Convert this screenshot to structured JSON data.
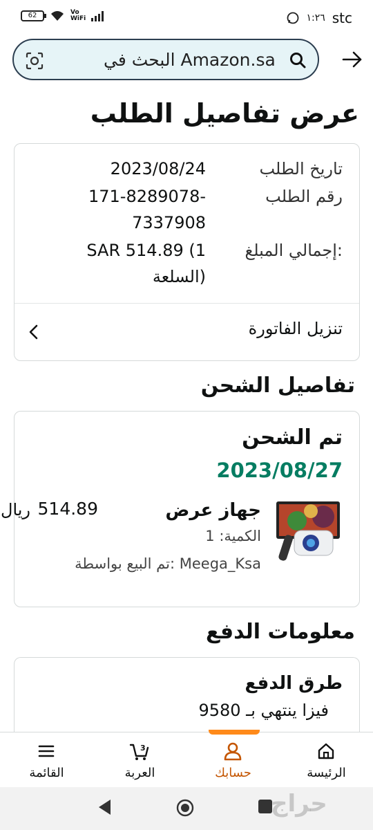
{
  "status_bar": {
    "battery": "62",
    "volte": "Vo",
    "wifi_label": "WiFi",
    "time": "١:٢٦",
    "carrier": "stc",
    "icons": [
      "battery-icon",
      "wifi-icon",
      "signal-icon",
      "whatsapp-icon"
    ]
  },
  "search": {
    "placeholder": "البحث في Amazon.sa"
  },
  "page": {
    "title": "عرض تفاصيل الطلب"
  },
  "order": {
    "date_label": "تاريخ الطلب",
    "date_value": "2023/08/24",
    "number_label": "رقم الطلب",
    "number_value_line1": "171-8289078-",
    "number_value_line2": "7337908",
    "total_label": "إجمالي المبلغ:",
    "total_value_line1": "SAR 514.89 (1",
    "total_value_line2": "السلعة)",
    "invoice_label": "تنزيل الفاتورة"
  },
  "shipping": {
    "section_title": "تفاصيل الشحن",
    "status": "تم الشحن",
    "date": "2023/08/27",
    "date_color": "#067d62",
    "item": {
      "title": "جهاز عرض",
      "quantity": "الكمية: 1",
      "seller": "تم البيع بواسطة: Meega_Ksa",
      "price": "514.89",
      "currency": "ريال"
    }
  },
  "payment": {
    "section_title": "معلومات الدفع",
    "methods_label": "طرق الدفع",
    "card_text": "فيزا ينتهي بـ 9580"
  },
  "bottom_nav": {
    "items": [
      {
        "label": "الرئيسة",
        "icon": "home-icon"
      },
      {
        "label": "حسابك",
        "icon": "account-icon",
        "active": true
      },
      {
        "label": "العربة",
        "icon": "cart-icon",
        "badge": "3"
      },
      {
        "label": "القائمة",
        "icon": "menu-icon"
      }
    ],
    "active_color": "#ff8a1a"
  },
  "watermark": "حراج"
}
